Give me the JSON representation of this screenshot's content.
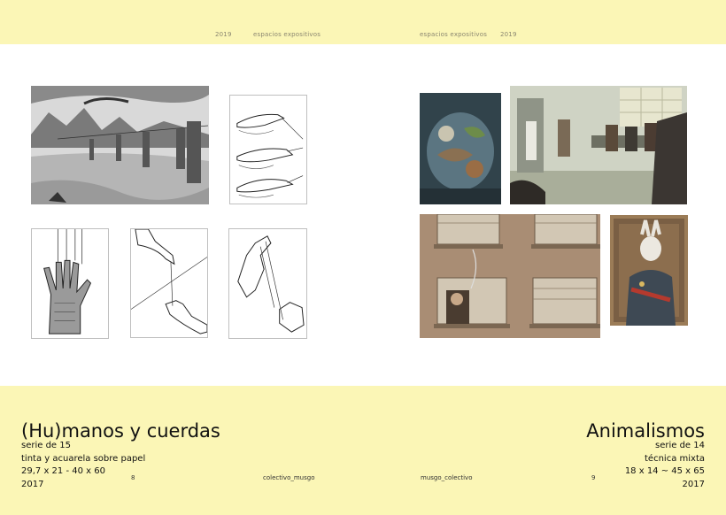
{
  "header": {
    "left_year": "2019",
    "left_label": "espacios expositivos",
    "right_label": "espacios expositivos",
    "right_year": "2019"
  },
  "left_series": {
    "title": "(Hu)manos y cuerdas",
    "lines": [
      "serie de 15",
      "tinta y acuarela sobre papel",
      "29,7 x 21 - 40 x 60",
      "2017"
    ]
  },
  "right_series": {
    "title": "Animalismos",
    "lines": [
      "serie de 14",
      "técnica mixta",
      "18 x 14 ~ 45 x 65",
      "2017"
    ]
  },
  "footer": {
    "page_left": "8",
    "credit_left": "colectivo_musgo",
    "credit_right": "musgo_colectivo",
    "page_right": "9"
  },
  "colors": {
    "band": "#fbf6b6",
    "text": "#111111"
  }
}
